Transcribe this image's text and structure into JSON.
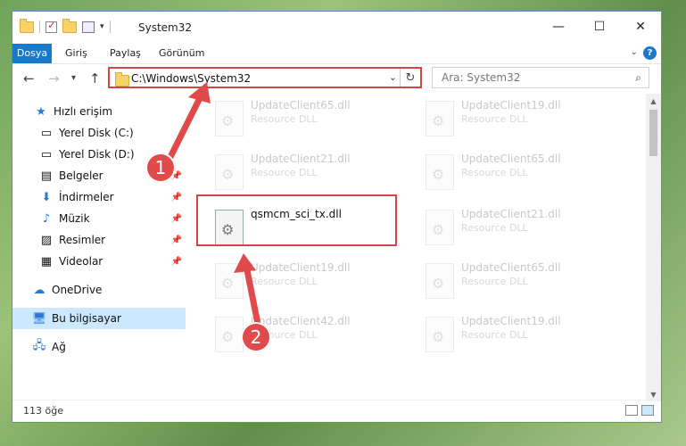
{
  "window": {
    "title": "System32"
  },
  "ribbon": {
    "tabs": [
      "Dosya",
      "Giriş",
      "Paylaş",
      "Görünüm"
    ]
  },
  "nav": {
    "address": "C:\\Windows\\System32",
    "search_placeholder": "Ara: System32"
  },
  "sidebar": {
    "items": [
      {
        "label": "Hızlı erişim",
        "icon": "star-icon"
      },
      {
        "label": "Yerel Disk (C:)",
        "icon": "drive-icon"
      },
      {
        "label": "Yerel Disk (D:)",
        "icon": "drive-icon"
      },
      {
        "label": "Belgeler",
        "icon": "documents-icon"
      },
      {
        "label": "İndirmeler",
        "icon": "download-icon"
      },
      {
        "label": "Müzik",
        "icon": "music-icon"
      },
      {
        "label": "Resimler",
        "icon": "pictures-icon"
      },
      {
        "label": "Videolar",
        "icon": "video-icon"
      },
      {
        "label": "OneDrive",
        "icon": "cloud-icon"
      },
      {
        "label": "Bu bilgisayar",
        "icon": "computer-icon"
      },
      {
        "label": "Ağ",
        "icon": "network-icon"
      }
    ]
  },
  "files": [
    {
      "name": "UpdateClient65.dll",
      "type": "Resource DLL"
    },
    {
      "name": "UpdateClient19.dll",
      "type": "Resource DLL"
    },
    {
      "name": "UpdateClient21.dll",
      "type": "Resource DLL"
    },
    {
      "name": "UpdateClient65.dll",
      "type": "Resource DLL"
    },
    {
      "name": "qsmcm_sci_tx.dll",
      "type": ""
    },
    {
      "name": "UpdateClient21.dll",
      "type": "Resource DLL"
    },
    {
      "name": "UpdateClient19.dll",
      "type": "Resource DLL"
    },
    {
      "name": "UpdateClient65.dll",
      "type": "Resource DLL"
    },
    {
      "name": "UpdateClient42.dll",
      "type": "Resource DLL"
    },
    {
      "name": "UpdateClient19.dll",
      "type": "Resource DLL"
    }
  ],
  "status": {
    "item_count": "113 öğe"
  },
  "callouts": {
    "one": "1",
    "two": "2"
  },
  "colors": {
    "accent": "#1979ca",
    "highlight": "#d64545",
    "selected": "#cce8ff"
  }
}
